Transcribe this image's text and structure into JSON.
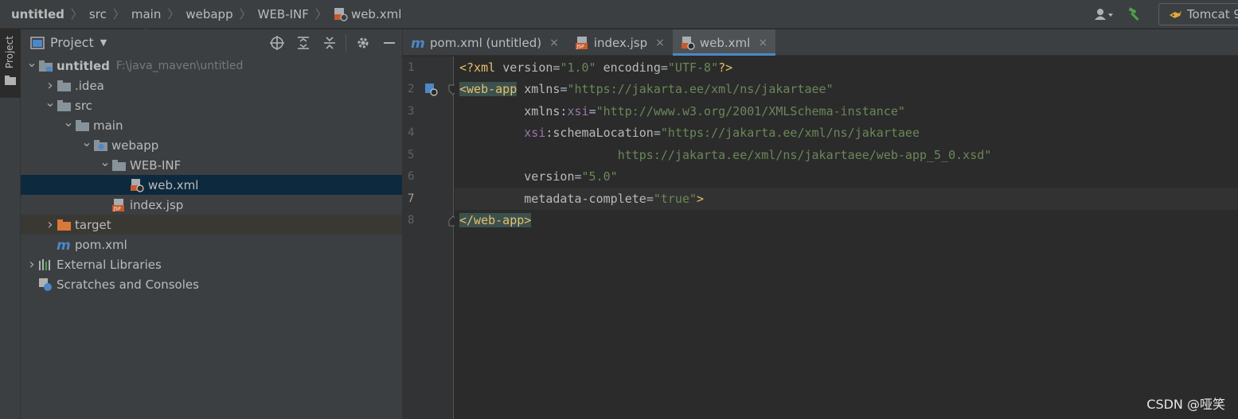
{
  "breadcrumb": [
    "untitled",
    "src",
    "main",
    "webapp",
    "WEB-INF",
    "web.xml"
  ],
  "toolbar": {
    "run_config_label": "Tomcat 9"
  },
  "project_panel": {
    "strip_label": "Project",
    "title": "Project",
    "tree": [
      {
        "label": "untitled",
        "path": "F:\\java_maven\\untitled",
        "indent": 0,
        "arrow": "down",
        "icon": "module-folder-icon",
        "bold": true
      },
      {
        "label": ".idea",
        "indent": 1,
        "arrow": "right",
        "icon": "folder-icon"
      },
      {
        "label": "src",
        "indent": 1,
        "arrow": "down",
        "icon": "folder-icon"
      },
      {
        "label": "main",
        "indent": 2,
        "arrow": "down",
        "icon": "folder-icon"
      },
      {
        "label": "webapp",
        "indent": 3,
        "arrow": "down",
        "icon": "web-folder-icon"
      },
      {
        "label": "WEB-INF",
        "indent": 4,
        "arrow": "down",
        "icon": "folder-icon"
      },
      {
        "label": "web.xml",
        "indent": 5,
        "arrow": "",
        "icon": "web-xml-icon",
        "selected": true
      },
      {
        "label": "index.jsp",
        "indent": 4,
        "arrow": "",
        "icon": "jsp-icon"
      },
      {
        "label": "target",
        "indent": 1,
        "arrow": "right",
        "icon": "excluded-folder-icon",
        "excluded": true
      },
      {
        "label": "pom.xml",
        "indent": 1,
        "arrow": "",
        "icon": "maven-icon"
      },
      {
        "label": "External Libraries",
        "indent": 0,
        "arrow": "right",
        "icon": "libraries-icon"
      },
      {
        "label": "Scratches and Consoles",
        "indent": 0,
        "arrow": "",
        "icon": "scratches-icon"
      }
    ]
  },
  "editor": {
    "tabs": [
      {
        "label": "pom.xml (untitled)",
        "icon": "maven-icon",
        "active": false
      },
      {
        "label": "index.jsp",
        "icon": "jsp-icon",
        "active": false
      },
      {
        "label": "web.xml",
        "icon": "web-xml-icon",
        "active": true
      }
    ],
    "close_glyph": "×",
    "current_line": 7,
    "lines": [
      {
        "n": "1",
        "tokens": [
          {
            "t": "<?xml ",
            "c": "pi"
          },
          {
            "t": "version",
            "c": "attr"
          },
          {
            "t": "=",
            "c": "txt"
          },
          {
            "t": "\"1.0\"",
            "c": "str"
          },
          {
            "t": " ",
            "c": "txt"
          },
          {
            "t": "encoding",
            "c": "attr"
          },
          {
            "t": "=",
            "c": "txt"
          },
          {
            "t": "\"UTF-8\"",
            "c": "str"
          },
          {
            "t": "?>",
            "c": "pi"
          }
        ]
      },
      {
        "n": "2",
        "tokens": [
          {
            "t": "<web-app",
            "c": "tagbg"
          },
          {
            "t": " ",
            "c": "txt"
          },
          {
            "t": "xmlns",
            "c": "attr"
          },
          {
            "t": "=",
            "c": "txt"
          },
          {
            "t": "\"https://jakarta.ee/xml/ns/jakartaee\"",
            "c": "str"
          }
        ]
      },
      {
        "n": "3",
        "tokens": [
          {
            "t": "         ",
            "c": "txt"
          },
          {
            "t": "xmlns:",
            "c": "attr"
          },
          {
            "t": "xsi",
            "c": "ns"
          },
          {
            "t": "=",
            "c": "txt"
          },
          {
            "t": "\"http://www.w3.org/2001/XMLSchema-instance\"",
            "c": "str"
          }
        ]
      },
      {
        "n": "4",
        "tokens": [
          {
            "t": "         ",
            "c": "txt"
          },
          {
            "t": "xsi",
            "c": "ns"
          },
          {
            "t": ":schemaLocation",
            "c": "attr"
          },
          {
            "t": "=",
            "c": "txt"
          },
          {
            "t": "\"https://jakarta.ee/xml/ns/jakartaee",
            "c": "str"
          }
        ]
      },
      {
        "n": "5",
        "tokens": [
          {
            "t": "                      ",
            "c": "txt"
          },
          {
            "t": "https://jakarta.ee/xml/ns/jakartaee/web-app_5_0.xsd\"",
            "c": "str"
          }
        ]
      },
      {
        "n": "6",
        "tokens": [
          {
            "t": "         ",
            "c": "txt"
          },
          {
            "t": "version",
            "c": "attr"
          },
          {
            "t": "=",
            "c": "txt"
          },
          {
            "t": "\"5.0\"",
            "c": "str"
          }
        ]
      },
      {
        "n": "7",
        "tokens": [
          {
            "t": "         ",
            "c": "txt"
          },
          {
            "t": "metadata-complete",
            "c": "attr"
          },
          {
            "t": "=",
            "c": "txt"
          },
          {
            "t": "\"true\"",
            "c": "str"
          },
          {
            "t": ">",
            "c": "tag"
          }
        ]
      },
      {
        "n": "8",
        "tokens": [
          {
            "t": "</web-app>",
            "c": "tagbg"
          }
        ]
      }
    ]
  },
  "watermark": "CSDN @哑笑",
  "colors": {
    "accent": "#4a88c7",
    "selection": "#0d293e",
    "string": "#6a8759",
    "tag": "#e8bf6a",
    "namespace": "#9876aa"
  }
}
